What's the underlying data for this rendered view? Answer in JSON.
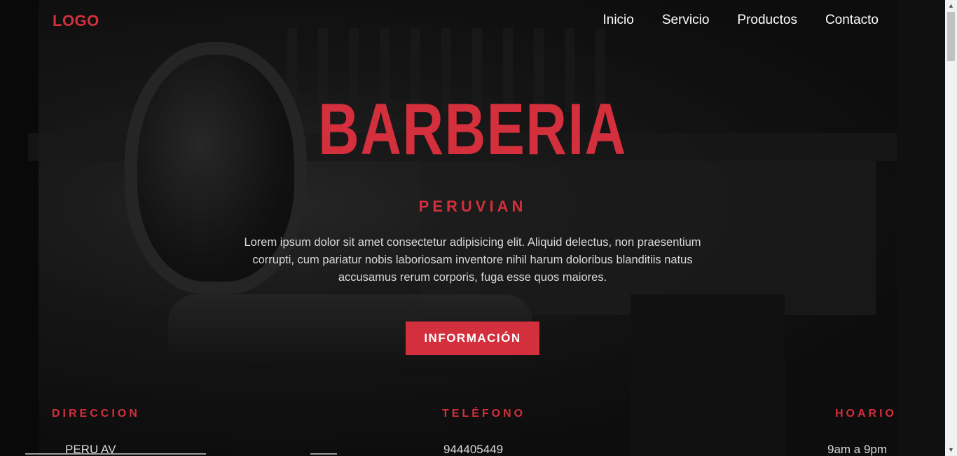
{
  "navbar": {
    "logo": "LOGO",
    "links": [
      "Inicio",
      "Servicio",
      "Productos",
      "Contacto"
    ]
  },
  "hero": {
    "title": "BARBERIA",
    "subtitle": "PERUVIAN",
    "text": "Lorem ipsum dolor sit amet consectetur adipisicing elit. Aliquid delectus, non praesentium corrupti, cum pariatur nobis laboriosam inventore nihil harum doloribus blanditiis natus accusamus rerum corporis, fuga esse quos maiores.",
    "button_label": "INFORMACIÓN"
  },
  "info": {
    "address_label": "DIRECCION",
    "address_value": "PERU AV",
    "phone_label": "TELÉFONO",
    "phone_value": "944405449",
    "hours_label": "HOARIO",
    "hours_value": "9am a 9pm"
  },
  "scrollbar": {
    "up_icon": "scroll-up-arrow",
    "down_icon": "scroll-down-arrow"
  },
  "colors": {
    "accent": "#d32f3c",
    "text": "#ffffff",
    "muted_text": "#d9d9d9"
  }
}
